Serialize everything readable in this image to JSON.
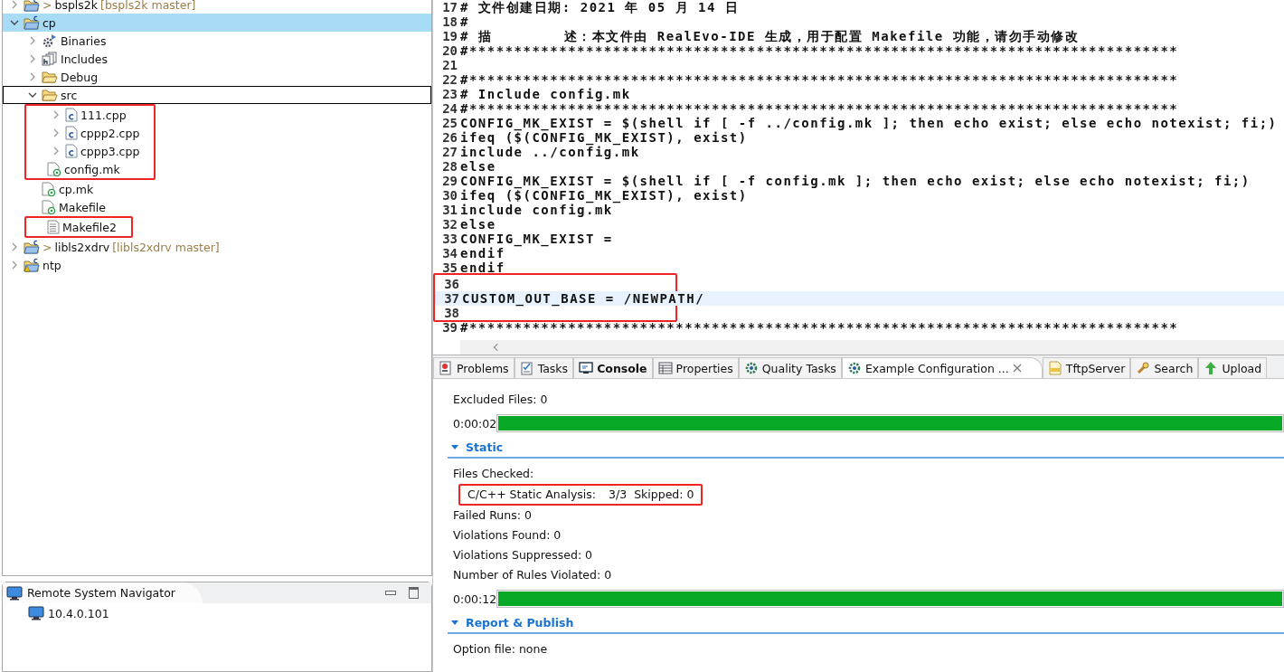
{
  "project_tree": [
    {
      "name": "bspls2k",
      "prefix": ">",
      "decoration": "[bspls2k master]",
      "kind": "project",
      "expanded": false,
      "selected": false,
      "focused": false,
      "marked": false
    },
    {
      "name": "cp",
      "kind": "project",
      "expanded": true,
      "selected": true,
      "focused": false,
      "marked": false,
      "children": [
        {
          "name": "Binaries",
          "kind": "binaries",
          "expanded": false,
          "selected": false,
          "focused": false,
          "marked": false
        },
        {
          "name": "Includes",
          "kind": "includes",
          "expanded": false,
          "selected": false,
          "focused": false,
          "marked": false
        },
        {
          "name": "Debug",
          "kind": "folder",
          "expanded": false,
          "selected": false,
          "focused": false,
          "marked": false
        },
        {
          "name": "src",
          "kind": "folder",
          "expanded": true,
          "selected": false,
          "focused": true,
          "marked": false,
          "children": [
            {
              "name": "111.cpp",
              "kind": "source",
              "expanded": false,
              "selected": false,
              "marked": true
            },
            {
              "name": "cppp2.cpp",
              "kind": "source",
              "expanded": false,
              "selected": false,
              "marked": true
            },
            {
              "name": "cppp3.cpp",
              "kind": "source",
              "expanded": false,
              "selected": false,
              "marked": true
            }
          ]
        },
        {
          "name": "config.mk",
          "kind": "makefile",
          "selected": false,
          "focused": false,
          "marked": true
        },
        {
          "name": "cp.mk",
          "kind": "makefile",
          "selected": false,
          "focused": false,
          "marked": false
        },
        {
          "name": "Makefile",
          "kind": "makefile",
          "selected": false,
          "focused": false,
          "marked": false
        },
        {
          "name": "Makefile2",
          "kind": "text",
          "selected": false,
          "focused": false,
          "marked": true
        }
      ]
    },
    {
      "name": "libls2xdrv",
      "prefix": ">",
      "decoration": "[libls2xdrv master]",
      "kind": "project",
      "expanded": false,
      "selected": false,
      "focused": false,
      "marked": false
    },
    {
      "name": "ntp",
      "kind": "project",
      "warning": true,
      "expanded": false,
      "selected": false,
      "focused": false,
      "marked": false
    }
  ],
  "remote_navigator": {
    "title": "Remote System Navigator",
    "hosts": [
      {
        "name": "10.4.0.101"
      }
    ]
  },
  "editor": {
    "lines": [
      {
        "number": "17",
        "text": "# 文件创建日期: 2021 年 05 月 14 日",
        "current": false,
        "marked": false
      },
      {
        "number": "18",
        "text": "#",
        "current": false,
        "marked": false
      },
      {
        "number": "19",
        "text": "# 描        述：本文件由 RealEvo-IDE 生成，用于配置 Makefile 功能，请勿手动修改",
        "current": false,
        "marked": false
      },
      {
        "number": "20",
        "text": "#*******************************************************************************",
        "current": false,
        "marked": false
      },
      {
        "number": "21",
        "current": false,
        "marked": false
      },
      {
        "number": "22",
        "text": "#*******************************************************************************",
        "current": false,
        "marked": false
      },
      {
        "number": "23",
        "text": "# Include config.mk",
        "current": false,
        "marked": false
      },
      {
        "number": "24",
        "text": "#*******************************************************************************",
        "current": false,
        "marked": false
      },
      {
        "number": "25",
        "text": "CONFIG_MK_EXIST = $(shell if [ -f ../config.mk ]; then echo exist; else echo notexist; fi;)",
        "current": false,
        "marked": false
      },
      {
        "number": "26",
        "text": "ifeq ($(CONFIG_MK_EXIST), exist)",
        "current": false,
        "marked": false
      },
      {
        "number": "27",
        "text": "include ../config.mk",
        "current": false,
        "marked": false
      },
      {
        "number": "28",
        "text": "else",
        "current": false,
        "marked": false
      },
      {
        "number": "29",
        "text": "CONFIG_MK_EXIST = $(shell if [ -f config.mk ]; then echo exist; else echo notexist; fi;)",
        "current": false,
        "marked": false
      },
      {
        "number": "30",
        "text": "ifeq ($(CONFIG_MK_EXIST), exist)",
        "current": false,
        "marked": false
      },
      {
        "number": "31",
        "text": "include config.mk",
        "current": false,
        "marked": false
      },
      {
        "number": "32",
        "text": "else",
        "current": false,
        "marked": false
      },
      {
        "number": "33",
        "text": "CONFIG_MK_EXIST =",
        "current": false,
        "marked": false
      },
      {
        "number": "34",
        "text": "endif",
        "current": false,
        "marked": false
      },
      {
        "number": "35",
        "text": "endif",
        "current": false,
        "marked": false
      },
      {
        "number": "36",
        "current": false,
        "marked": true
      },
      {
        "number": "37",
        "text": "CUSTOM_OUT_BASE = /NEWPATH/",
        "current": true,
        "marked": true
      },
      {
        "number": "38",
        "current": false,
        "marked": true
      },
      {
        "number": "39",
        "text": "#*******************************************************************************",
        "current": false,
        "marked": false
      }
    ]
  },
  "bottom_tabs": [
    {
      "label": "Problems",
      "kind": "problems",
      "selected": false,
      "bold": false
    },
    {
      "label": "Tasks",
      "kind": "tasks",
      "selected": false,
      "bold": false
    },
    {
      "label": "Console",
      "kind": "console",
      "selected": false,
      "bold": true
    },
    {
      "label": "Properties",
      "kind": "properties",
      "selected": false,
      "bold": false
    },
    {
      "label": "Quality Tasks",
      "kind": "quality",
      "selected": false,
      "bold": false
    },
    {
      "label": "Example Configuration ...",
      "kind": "quality",
      "selected": true,
      "bold": false
    },
    {
      "label": "TftpServer",
      "kind": "tftp",
      "selected": false,
      "bold": false
    },
    {
      "label": "Search",
      "kind": "search",
      "selected": false,
      "bold": false
    },
    {
      "label": "Upload",
      "kind": "upload",
      "selected": false,
      "bold": false
    }
  ],
  "report": [
    {
      "kind": "text",
      "text": "Excluded Files: 0",
      "marked": false
    },
    {
      "kind": "progress",
      "text": "0:00:02",
      "level": 1,
      "marked": false
    },
    {
      "kind": "section",
      "text": "Static",
      "expanded": true,
      "marked": false
    },
    {
      "kind": "text",
      "text": "Files Checked:",
      "marked": false,
      "children": [
        {
          "kind": "stat",
          "text": "C/C++ Static Analysis:",
          "value": "3/3",
          "extra": "Skipped: 0",
          "marked": true
        }
      ]
    },
    {
      "kind": "text",
      "text": "Failed Runs: 0",
      "marked": false
    },
    {
      "kind": "text",
      "text": "Violations Found: 0",
      "marked": false
    },
    {
      "kind": "text",
      "text": "Violations Suppressed: 0",
      "marked": false
    },
    {
      "kind": "text",
      "text": "Number of Rules Violated: 0",
      "marked": false
    },
    {
      "kind": "progress",
      "text": "0:00:12",
      "level": 1,
      "marked": false
    },
    {
      "kind": "section",
      "text": "Report & Publish",
      "expanded": true,
      "marked": false
    },
    {
      "kind": "text",
      "text": "Option file: none",
      "marked": false
    }
  ]
}
